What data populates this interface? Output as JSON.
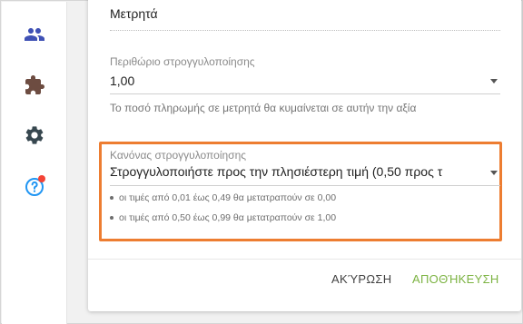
{
  "colors": {
    "accent": "#3f51b5",
    "highlight": "#ed7d31",
    "save": "#7cb342",
    "notification_dot": "#f44336"
  },
  "sidebar": {
    "items": [
      {
        "icon": "people-icon"
      },
      {
        "icon": "puzzle-icon"
      },
      {
        "icon": "gear-icon"
      },
      {
        "icon": "help-icon",
        "badge": true
      }
    ]
  },
  "form": {
    "payment_type": {
      "value": "Μετρητά"
    },
    "rounding_margin": {
      "label": "Περιθώριο στρογγυλοποίησης",
      "value": "1,00",
      "hint": "Το ποσό πληρωμής σε μετρητά θα κυμαίνεται σε αυτήν την αξία"
    },
    "rounding_rule": {
      "label": "Κανόνας στρογγυλοποίησης",
      "value": "Στρογγυλοποιήστε προς την πλησιέστερη τιμή (0,50 προς τ",
      "details": [
        "οι τιμές από 0,01 έως 0,49 θα μετατραπούν σε 0,00",
        "οι τιμές από 0,50 έως 0,99 θα μετατραπούν σε 1,00"
      ]
    }
  },
  "actions": {
    "cancel_label": "ΑΚΎΡΩΣΗ",
    "save_label": "ΑΠΟΘΉΚΕΥΣΗ"
  }
}
